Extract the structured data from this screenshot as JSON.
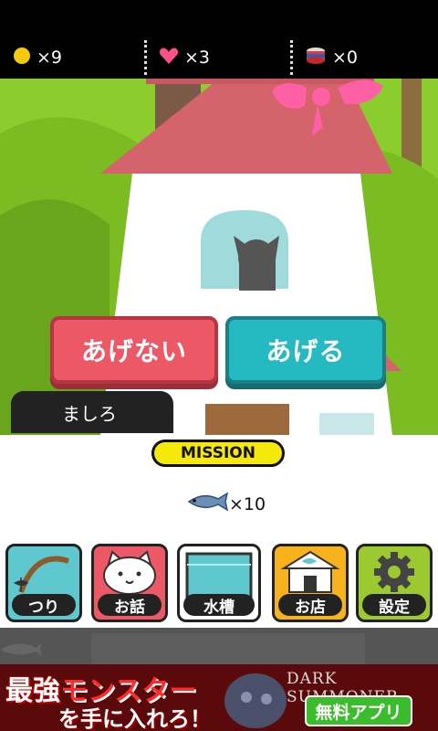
{
  "stats": {
    "coins": "×9",
    "hearts": "×3",
    "cans": "×0"
  },
  "dialog": {
    "decline_label": "あげない",
    "give_label": "あげる",
    "cat_name": "ましろ"
  },
  "mission": {
    "badge_label": "MISSION",
    "reward_count": "×10"
  },
  "nav": {
    "items": [
      {
        "label": "つり",
        "icon": "fishing-rod-icon",
        "color": "#5fc8cf"
      },
      {
        "label": "お話",
        "icon": "cat-face-icon",
        "color": "#ec5866"
      },
      {
        "label": "水槽",
        "icon": "aquarium-icon",
        "color": "#5fc8cf"
      },
      {
        "label": "お店",
        "icon": "shop-icon",
        "color": "#f7b21c"
      },
      {
        "label": "設定",
        "icon": "gear-icon",
        "color": "#9bc92f"
      }
    ]
  },
  "ad": {
    "headline_red": "最強",
    "headline_white": "モンスター",
    "headline_line2": "を手に入れろ！",
    "brand": "DARK SUMMONER",
    "cta": "無料アプリ"
  },
  "colors": {
    "grass": "#8ccd2e",
    "roof": "#d5636b",
    "ribbon": "#ff5fa5",
    "mission_yellow": "#f5e90b"
  }
}
